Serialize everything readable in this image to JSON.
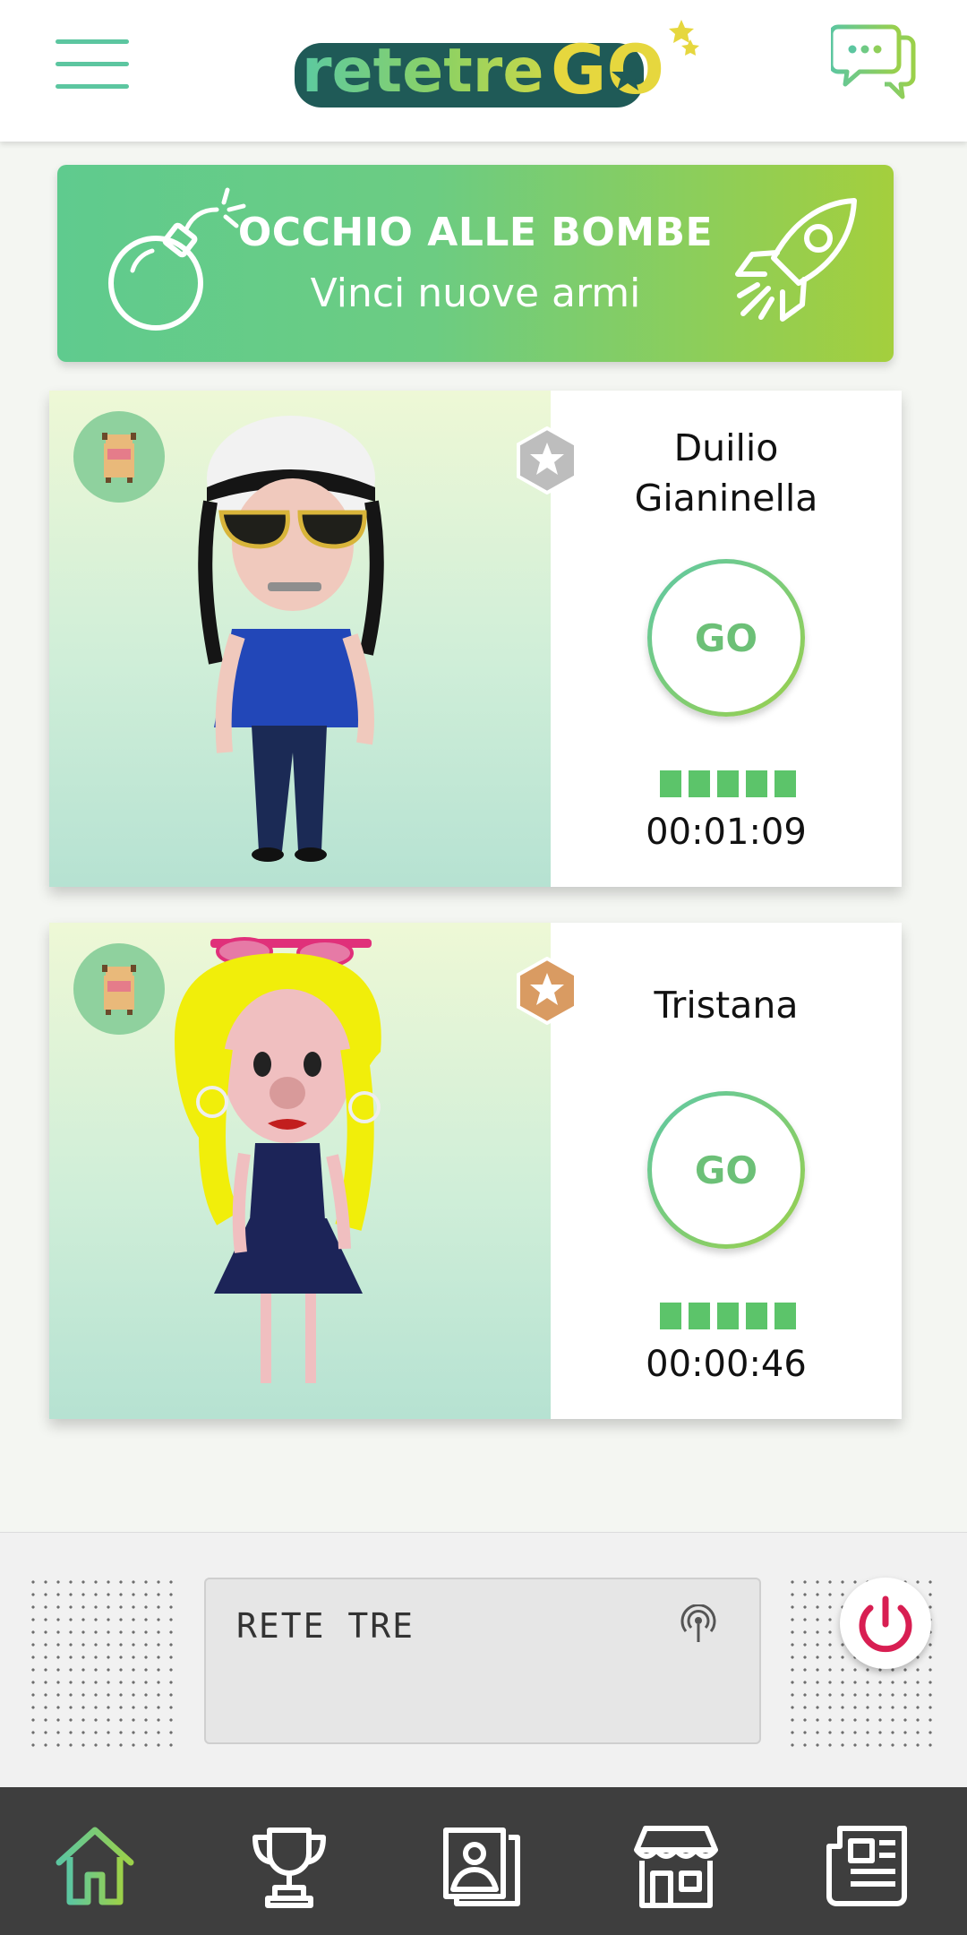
{
  "app": {
    "logo_text": "retetreGO"
  },
  "banner": {
    "title": "OCCHIO ALLE BOMBE",
    "subtitle": "Vinci nuove armi"
  },
  "players": [
    {
      "name": "Duilio\nGianinella",
      "go_label": "GO",
      "energy_bars": 5,
      "timer": "00:01:09",
      "rank_color": "#bdbdbd"
    },
    {
      "name": "Tristana",
      "go_label": "GO",
      "energy_bars": 5,
      "timer": "00:00:46",
      "rank_color": "#d99b62"
    }
  ],
  "radio": {
    "station": "RETE TRE"
  },
  "nav": {
    "items": [
      "home-icon",
      "trophy-icon",
      "gallery-icon",
      "shop-icon",
      "news-icon"
    ],
    "active": 0
  },
  "colors": {
    "accent_green": "#5cc6a0",
    "lime": "#a4cf3d",
    "power_red": "#d81e52",
    "nav_bg": "#3e3e3e"
  }
}
